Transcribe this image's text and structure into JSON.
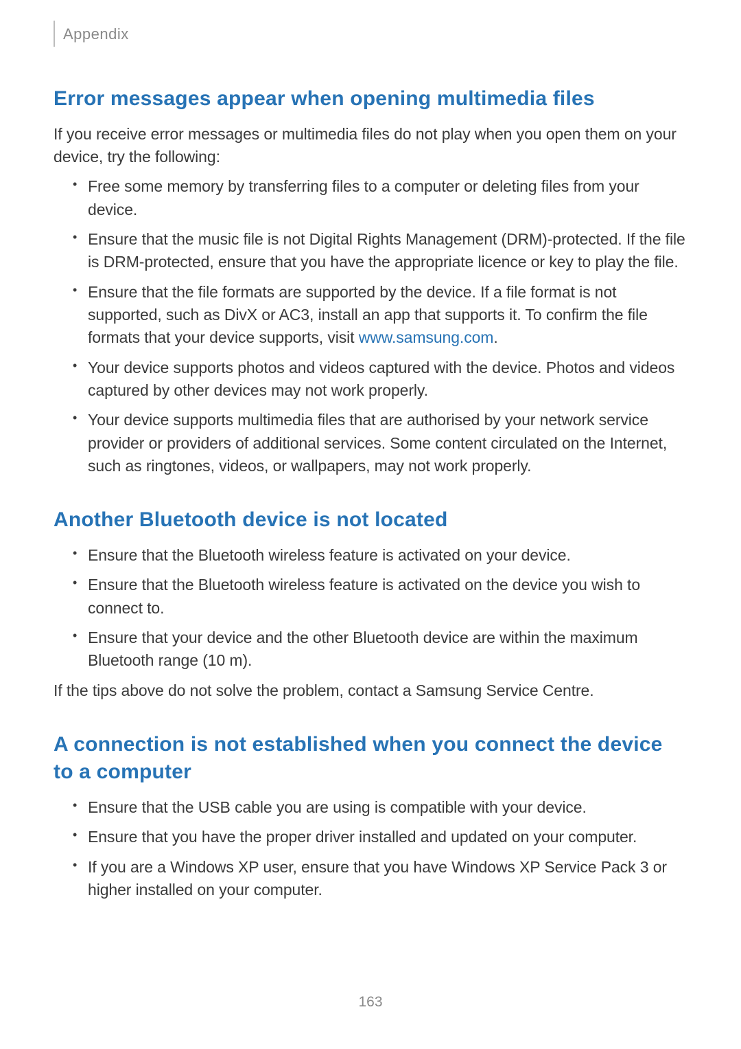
{
  "header": {
    "section": "Appendix"
  },
  "sections": {
    "s1": {
      "heading": "Error messages appear when opening multimedia files",
      "intro": "If you receive error messages or multimedia files do not play when you open them on your device, try the following:",
      "items": {
        "i0": "Free some memory by transferring files to a computer or deleting files from your device.",
        "i1": "Ensure that the music file is not Digital Rights Management (DRM)-protected. If the file is DRM-protected, ensure that you have the appropriate licence or key to play the file.",
        "i2_pre": "Ensure that the file formats are supported by the device. If a file format is not supported, such as DivX or AC3, install an app that supports it. To confirm the file formats that your device supports, visit ",
        "i2_link": "www.samsung.com",
        "i2_post": ".",
        "i3": "Your device supports photos and videos captured with the device. Photos and videos captured by other devices may not work properly.",
        "i4": "Your device supports multimedia files that are authorised by your network service provider or providers of additional services. Some content circulated on the Internet, such as ringtones, videos, or wallpapers, may not work properly."
      }
    },
    "s2": {
      "heading": "Another Bluetooth device is not located",
      "items": {
        "i0": "Ensure that the Bluetooth wireless feature is activated on your device.",
        "i1": "Ensure that the Bluetooth wireless feature is activated on the device you wish to connect to.",
        "i2": "Ensure that your device and the other Bluetooth device are within the maximum Bluetooth range (10 m)."
      },
      "outro": "If the tips above do not solve the problem, contact a Samsung Service Centre."
    },
    "s3": {
      "heading": "A connection is not established when you connect the device to a computer",
      "items": {
        "i0": "Ensure that the USB cable you are using is compatible with your device.",
        "i1": "Ensure that you have the proper driver installed and updated on your computer.",
        "i2": "If you are a Windows XP user, ensure that you have Windows XP Service Pack 3 or higher installed on your computer."
      }
    }
  },
  "page_number": "163"
}
